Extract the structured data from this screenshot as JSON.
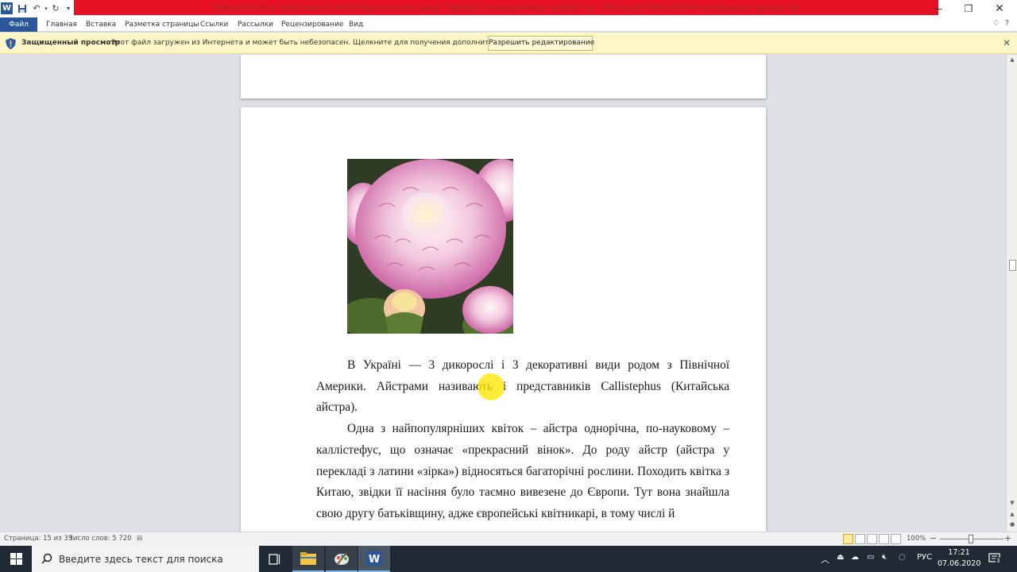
{
  "window": {
    "title": "Алелопатичні властивості квіткових рослин роду Tagetes (защищенный просмотр) - Microsoft Word (Сбой активации продукта)",
    "accent_color": "#2b579a",
    "title_bar_color": "#e81123"
  },
  "ribbon": {
    "tabs": [
      "Файл",
      "Главная",
      "Вставка",
      "Разметка страницы",
      "Ссылки",
      "Рассылки",
      "Рецензирование",
      "Вид"
    ]
  },
  "protected_view": {
    "title": "Защищенный просмотр",
    "message": "Этот файл загружен из Интернета и может быть небезопасен. Щелкните для получения дополнительных сведений.",
    "button_label": "Разрешить редактирование",
    "close_label": "✕"
  },
  "document": {
    "paragraphs": [
      "В Україні — 3 дикорослі і 3 декоративні види родом з Північної Америки. Айстрами називають і представників Callistephus (Китайська айстра).",
      "Одна з найпопулярніших квіток – айстра однорічна, по-науковому – каллістефус, що означає «прекрасний вінок». До роду айстр (айстра у перекладі з латини «зірка») відносяться багаторічні рослини. Походить квітка з Китаю, звідки її насіння було таємно вивезене до Європи. Тут вона знайшла свою другу батьківщину, адже європейські квітникарі, в тому числі й"
    ]
  },
  "status_bar": {
    "page_info": "Страница: 15 из 33",
    "word_count": "Число слов: 5 720",
    "zoom": "100%",
    "zoom_minus": "−",
    "zoom_plus": "+"
  },
  "taskbar": {
    "search_placeholder": "Введите здесь текст для поиска",
    "language": "РУС",
    "time": "17:21",
    "date": "07.06.2020",
    "notification_count": "3"
  }
}
